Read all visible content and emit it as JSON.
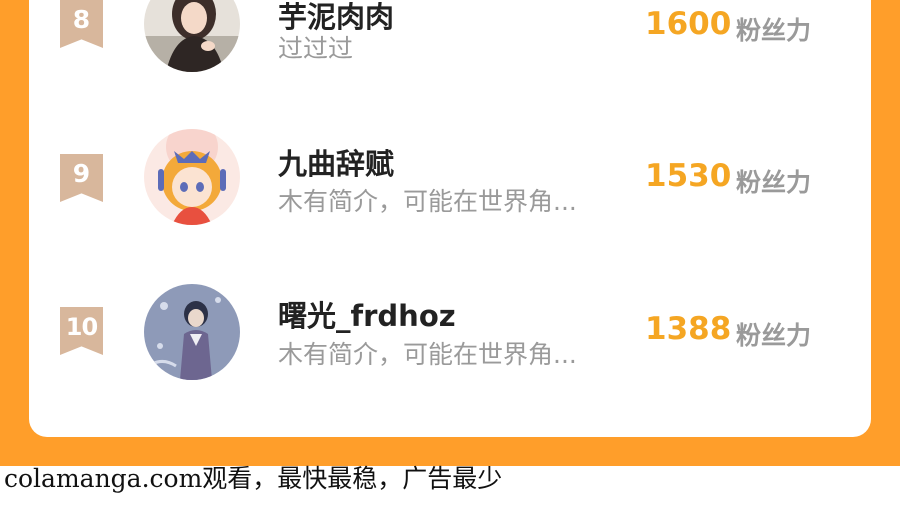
{
  "ranking": [
    {
      "rank": "8",
      "name": "芋泥肉肉",
      "bio": "过过过",
      "fans": "1600",
      "fans_unit": "粉丝力",
      "avatar_colors": [
        "#E6E1DA",
        "#3D2E2A",
        "#F4D9C8"
      ]
    },
    {
      "rank": "9",
      "name": "九曲辞赋",
      "bio": "木有简介，可能在世界角...",
      "fans": "1530",
      "fans_unit": "粉丝力",
      "avatar_colors": [
        "#FBE9E4",
        "#F3A93A",
        "#5C6CB8"
      ]
    },
    {
      "rank": "10",
      "name": "曙光_frdhoz",
      "bio": "木有简介，可能在世界角...",
      "fans": "1388",
      "fans_unit": "粉丝力",
      "avatar_colors": [
        "#8E9AB8",
        "#2C3147",
        "#6D6690"
      ]
    }
  ],
  "watermark": "colamanga.com观看，最快最稳，广告最少",
  "colors": {
    "frame": "#FF9E2A",
    "fans_number": "#F5A623",
    "badge": "#D8B79C",
    "secondary_text": "#9A9A9A"
  },
  "icons": [
    "rank-badge-icon",
    "avatar-image"
  ]
}
